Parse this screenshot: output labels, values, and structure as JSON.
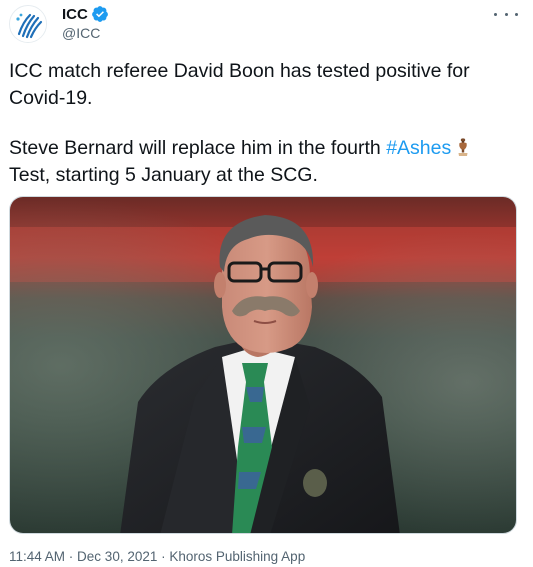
{
  "account": {
    "display_name": "ICC",
    "handle": "@ICC",
    "verified": true,
    "avatar_icon": "icc-logo-icon",
    "verified_icon": "verified-badge-icon"
  },
  "menu": {
    "icon": "more-options-icon"
  },
  "tweet": {
    "line1": "ICC match referee David Boon has tested positive for Covid-19.",
    "line2_before": "Steve Bernard will replace him in the fourth ",
    "hashtag": "#Ashes",
    "emoji_icon": "ashes-urn-trophy-icon",
    "line2_after": "Test, starting 5 January at the SCG."
  },
  "media": {
    "type": "photo",
    "subject": "man-with-mustache-in-suit-photo"
  },
  "meta": {
    "time": "11:44 AM",
    "separator1": " · ",
    "date": "Dec 30, 2021",
    "separator2": " · ",
    "source": "Khoros Publishing App"
  },
  "colors": {
    "link": "#1d9bf0",
    "text": "#0f1419",
    "secondary": "#536471",
    "verified": "#1d9bf0",
    "icc_logo_blue": "#1f6fb8"
  }
}
